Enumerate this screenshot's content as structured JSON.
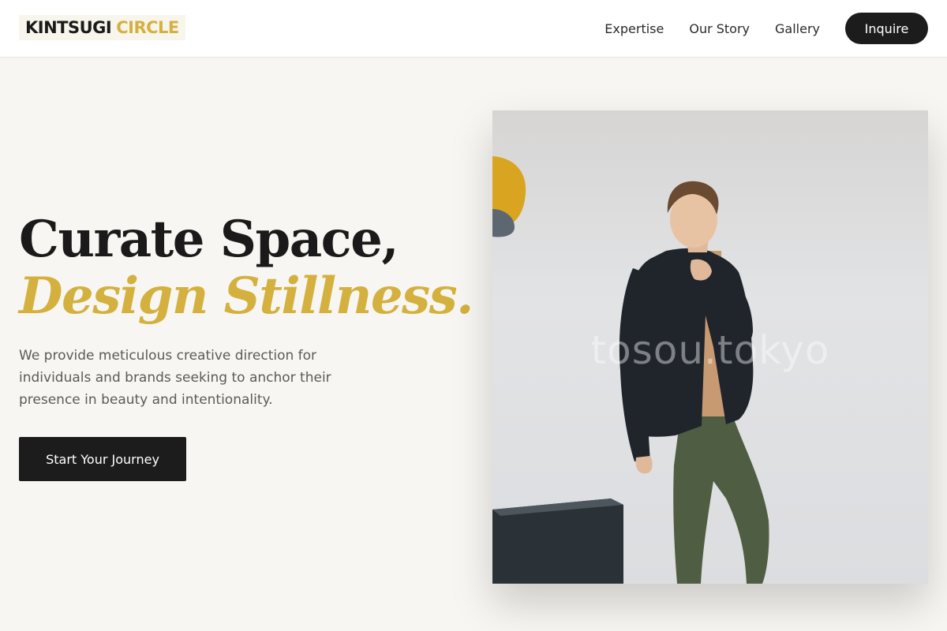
{
  "header": {
    "logo": {
      "part1": "KINTSUGI",
      "part2": "CIRCLE"
    },
    "nav": [
      {
        "label": "Expertise"
      },
      {
        "label": "Our Story"
      },
      {
        "label": "Gallery"
      }
    ],
    "cta_label": "Inquire"
  },
  "hero": {
    "title_line1": "Curate Space,",
    "title_line2": "Design Stillness.",
    "description": "We provide meticulous creative direction for individuals and brands seeking to anchor their presence in beauty and intentionality.",
    "cta_label": "Start Your Journey"
  },
  "photo": {
    "watermark": "tosou.tokyo"
  },
  "colors": {
    "accent_gold": "#d4b13f",
    "dark": "#1c1c1c",
    "background": "#f8f6f2"
  }
}
